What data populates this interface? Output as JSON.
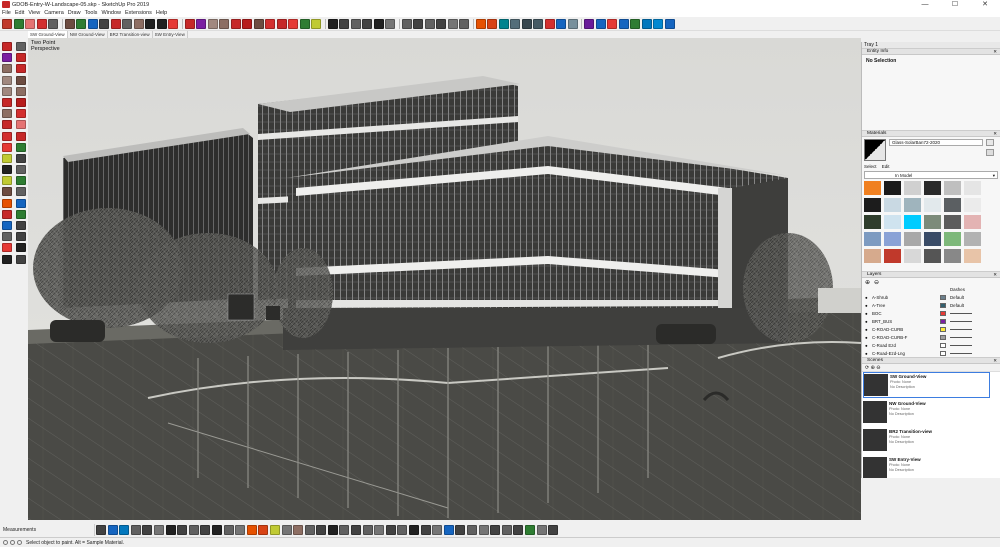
{
  "window": {
    "title": "GDOB-Entry-W-Landscape-05.skp - SketchUp Pro 2019",
    "min": "—",
    "max": "☐",
    "close": "✕"
  },
  "menu": [
    "File",
    "Edit",
    "View",
    "Camera",
    "Draw",
    "Tools",
    "Window",
    "Extensions",
    "Help"
  ],
  "toolbar_icons": [
    {
      "name": "select-icon",
      "color": "#c0392b"
    },
    {
      "name": "make-component-icon",
      "color": "#2e7d32"
    },
    {
      "name": "eraser-icon",
      "color": "#e57373"
    },
    {
      "name": "undo-icon",
      "color": "#d32f2f"
    },
    {
      "name": "redo-icon",
      "color": "#616161"
    },
    {
      "name": "paint-bucket-icon",
      "color": "#6d4c41"
    },
    {
      "name": "pan-icon",
      "color": "#2e7d32"
    },
    {
      "name": "orbit-icon",
      "color": "#1565c0"
    },
    {
      "name": "zoom-icon",
      "color": "#424242"
    },
    {
      "name": "zoom-window-icon",
      "color": "#c62828"
    },
    {
      "name": "zoom-extents-icon",
      "color": "#616161"
    },
    {
      "name": "previous-view-icon",
      "color": "#8d6e63"
    },
    {
      "name": "position-camera-icon",
      "color": "#212121"
    },
    {
      "name": "walk-icon",
      "color": "#212121"
    },
    {
      "name": "look-around-icon",
      "color": "#e53935"
    },
    {
      "name": "rectangle-icon",
      "color": "#c62828"
    },
    {
      "name": "line-icon",
      "color": "#7b1fa2"
    },
    {
      "name": "circle-icon",
      "color": "#a1887f"
    },
    {
      "name": "polygon-icon",
      "color": "#8d6e63"
    },
    {
      "name": "arc-icon",
      "color": "#c62828"
    },
    {
      "name": "freehand-icon",
      "color": "#b71c1c"
    },
    {
      "name": "move-icon",
      "color": "#6d4c41"
    },
    {
      "name": "push-pull-icon",
      "color": "#d32f2f"
    },
    {
      "name": "rotate-icon",
      "color": "#c62828"
    },
    {
      "name": "follow-me-icon",
      "color": "#e53935"
    },
    {
      "name": "scale-icon",
      "color": "#2e7d32"
    },
    {
      "name": "offset-icon",
      "color": "#c0ca33"
    },
    {
      "name": "tape-measure-icon",
      "color": "#212121"
    },
    {
      "name": "dimension-icon",
      "color": "#424242"
    },
    {
      "name": "protractor-icon",
      "color": "#616161"
    },
    {
      "name": "text-icon",
      "color": "#424242"
    },
    {
      "name": "axes-icon",
      "color": "#212121"
    },
    {
      "name": "3d-text-icon",
      "color": "#757575"
    },
    {
      "name": "iso-view-icon",
      "color": "#616161"
    },
    {
      "name": "top-view-icon",
      "color": "#424242"
    },
    {
      "name": "front-view-icon",
      "color": "#616161"
    },
    {
      "name": "right-view-icon",
      "color": "#424242"
    },
    {
      "name": "back-view-icon",
      "color": "#757575"
    },
    {
      "name": "left-view-icon",
      "color": "#616161"
    },
    {
      "name": "section-plane-icon",
      "color": "#e65100"
    },
    {
      "name": "display-section-icon",
      "color": "#d84315"
    },
    {
      "name": "xray-icon",
      "color": "#00838f"
    },
    {
      "name": "back-edges-icon",
      "color": "#546e7a"
    },
    {
      "name": "wireframe-icon",
      "color": "#37474f"
    },
    {
      "name": "hidden-line-icon",
      "color": "#455a64"
    },
    {
      "name": "shaded-icon",
      "color": "#d32f2f"
    },
    {
      "name": "shaded-textures-icon",
      "color": "#1565c0"
    },
    {
      "name": "monochrome-icon",
      "color": "#78909c"
    },
    {
      "name": "components-icon",
      "color": "#6a1b9a"
    },
    {
      "name": "warehouse-icon",
      "color": "#1565c0"
    },
    {
      "name": "extension-warehouse-icon",
      "color": "#e53935"
    },
    {
      "name": "send-layout-icon",
      "color": "#1565c0"
    },
    {
      "name": "geo-location-icon",
      "color": "#2e7d32"
    },
    {
      "name": "add-location-icon",
      "color": "#0277bd"
    },
    {
      "name": "download-icon",
      "color": "#0288d1"
    },
    {
      "name": "info-icon",
      "color": "#1565c0"
    }
  ],
  "left_tools": [
    "#c62828",
    "#616161",
    "#7b1fa2",
    "#c62828",
    "#8d6e63",
    "#c62828",
    "#a1887f",
    "#6d4c41",
    "#a1887f",
    "#8d6e63",
    "#c62828",
    "#b71c1c",
    "#8d6e63",
    "#d32f2f",
    "#c62828",
    "#e57373",
    "#d32f2f",
    "#c62828",
    "#e53935",
    "#2e7d32",
    "#c0ca33",
    "#424242",
    "#212121",
    "#616161",
    "#c0ca33",
    "#2e7d32",
    "#6d4c41",
    "#616161",
    "#e65100",
    "#1565c0",
    "#c62828",
    "#2e7d32",
    "#1565c0",
    "#424242",
    "#616161",
    "#424242",
    "#e53935",
    "#212121",
    "#212121",
    "#424242"
  ],
  "scene_tabs": [
    "SW Ground-View",
    "NW Ground-View",
    "BR2 Transition-view",
    "SW Entry-View"
  ],
  "camera_label": [
    "Two Point",
    "Perspective"
  ],
  "tray": {
    "title": "Tray 1",
    "entity_info": {
      "head": "Entity Info",
      "value": "No Selection"
    },
    "materials": {
      "head": "Materials",
      "name": "Glass-SolarBan72-2020",
      "tabs": [
        "Select",
        "Edit"
      ],
      "library": "In Model",
      "swatches": [
        "#f08020",
        "#1a1a1a",
        "#d0d0d0",
        "#2a2a2a",
        "#bfbfbf",
        "#e5e5e5",
        "#1c1c1c",
        "#c9d9e3",
        "#9fb4bd",
        "#e2e9ec",
        "#5b5f62",
        "#ebebeb",
        "#2f3d2c",
        "#cfe3ef",
        "#00ccff",
        "#7c8b7a",
        "#5c5c5c",
        "#e3b3b3",
        "#7d9bc1",
        "#8aa2d6",
        "#a8a8a8",
        "#394b66",
        "#7db87a",
        "#b2b2b2",
        "#d6aa8d",
        "#c0392b",
        "#d8d8d8",
        "#555555",
        "#888888",
        "#e8c4a8"
      ]
    },
    "layers": {
      "head": "Layers",
      "col_dashes": "Dashes",
      "rows": [
        {
          "name": "A-Shrub",
          "color": "#6b7f8c",
          "dash": "Default"
        },
        {
          "name": "A-Tree",
          "color": "#33606f",
          "dash": "Default"
        },
        {
          "name": "BOC",
          "color": "#e53935",
          "dash": ""
        },
        {
          "name": "BRT_BUS",
          "color": "#7b1fa2",
          "dash": ""
        },
        {
          "name": "C-ROAD-CURB",
          "color": "#ffeb3b",
          "dash": ""
        },
        {
          "name": "C-ROAD-CURB-F",
          "color": "#9e9e9e",
          "dash": ""
        },
        {
          "name": "C-Road Ezd",
          "color": "#ffffff",
          "dash": ""
        },
        {
          "name": "C-Road-Ezd-Lng",
          "color": "#ffffff",
          "dash": ""
        }
      ]
    },
    "scenes": {
      "head": "Scenes",
      "items": [
        {
          "name": "SW Ground-View",
          "style": "Photo: None",
          "desc": "No Description"
        },
        {
          "name": "NW Ground-View",
          "style": "Photo: None",
          "desc": "No Description"
        },
        {
          "name": "BR2 Transition-view",
          "style": "Photo: None",
          "desc": "No Description"
        },
        {
          "name": "SW Entry-View",
          "style": "Photo: None",
          "desc": "No Description"
        }
      ]
    }
  },
  "status": {
    "measurements_label": "Measurements",
    "message": "Select object to paint. Alt = Sample Material."
  },
  "bottom_tool_colors": [
    "#424242",
    "#1565c0",
    "#0277bd",
    "#616161",
    "#424242",
    "#757575",
    "#212121",
    "#424242",
    "#616161",
    "#424242",
    "#212121",
    "#616161",
    "#757575",
    "#e65100",
    "#d84315",
    "#c0ca33",
    "#757575",
    "#8d6e63",
    "#616161",
    "#424242",
    "#212121",
    "#616161",
    "#424242",
    "#616161",
    "#757575",
    "#424242",
    "#616161",
    "#212121",
    "#424242",
    "#757575",
    "#1565c0",
    "#424242",
    "#616161",
    "#757575",
    "#424242",
    "#616161",
    "#424242",
    "#2e7d32",
    "#757575",
    "#424242"
  ]
}
